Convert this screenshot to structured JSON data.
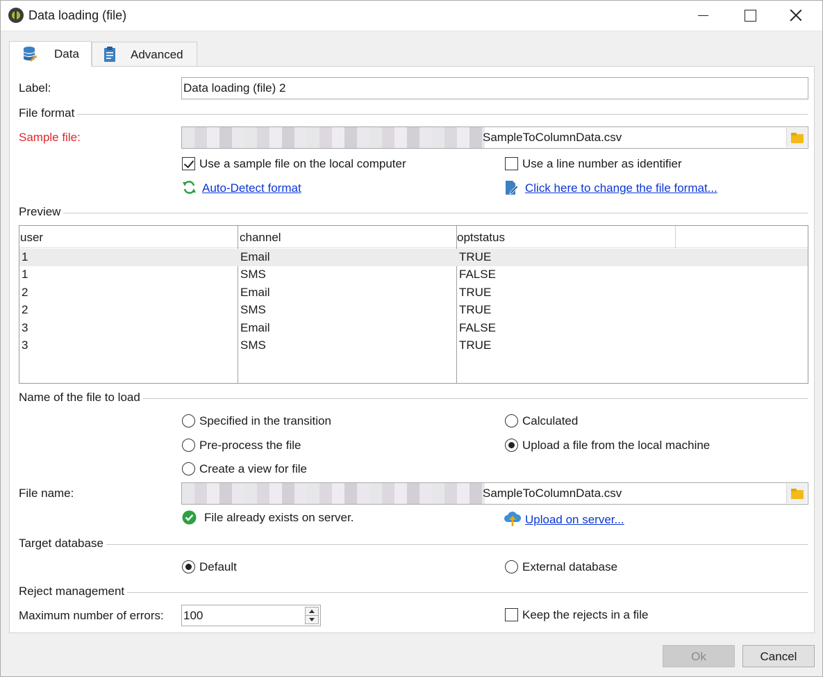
{
  "window": {
    "title": "Data loading (file)"
  },
  "tabs": [
    {
      "label": "Data"
    },
    {
      "label": "Advanced"
    }
  ],
  "label_field": {
    "label": "Label:",
    "value": "Data loading (file) 2"
  },
  "file_format": {
    "section": "File format",
    "sample_file_label": "Sample file:",
    "sample_file_value": "SampleToColumnData.csv",
    "use_sample_local": {
      "label": "Use a sample file on the local computer",
      "checked": true
    },
    "use_line_number": {
      "label": "Use a line number as identifier",
      "checked": false
    },
    "auto_detect": "Auto-Detect format",
    "change_format": "Click here to change the file format..."
  },
  "preview": {
    "section": "Preview",
    "columns": [
      "user",
      "channel",
      "optstatus"
    ],
    "rows": [
      [
        "1",
        "Email",
        "TRUE"
      ],
      [
        "1",
        "SMS",
        "FALSE"
      ],
      [
        "2",
        "Email",
        "TRUE"
      ],
      [
        "2",
        "SMS",
        "TRUE"
      ],
      [
        "3",
        "Email",
        "FALSE"
      ],
      [
        "3",
        "SMS",
        "TRUE"
      ]
    ]
  },
  "file_to_load": {
    "section": "Name of the file to load",
    "options": {
      "specified": "Specified in the transition",
      "calculated": "Calculated",
      "preprocess": "Pre-process the file",
      "upload_local": "Upload a file from the local machine",
      "create_view": "Create a view for file"
    },
    "selected": "upload_local",
    "file_name_label": "File name:",
    "file_name_value": "SampleToColumnData.csv",
    "exists_status": "File already exists on server.",
    "upload_link": "Upload on server..."
  },
  "target_database": {
    "section": "Target database",
    "default_label": "Default",
    "external_label": "External database",
    "selected": "default"
  },
  "reject_management": {
    "section": "Reject management",
    "max_errors_label": "Maximum number of errors:",
    "max_errors_value": "100",
    "keep_rejects": {
      "label": "Keep the rejects in a file",
      "checked": false
    }
  },
  "buttons": {
    "ok": "Ok",
    "cancel": "Cancel",
    "ok_enabled": false
  },
  "colors": {
    "required_label": "#e0262b",
    "link": "#0b35d6",
    "success": "#2ea043",
    "folder": "#f2bb1a"
  }
}
